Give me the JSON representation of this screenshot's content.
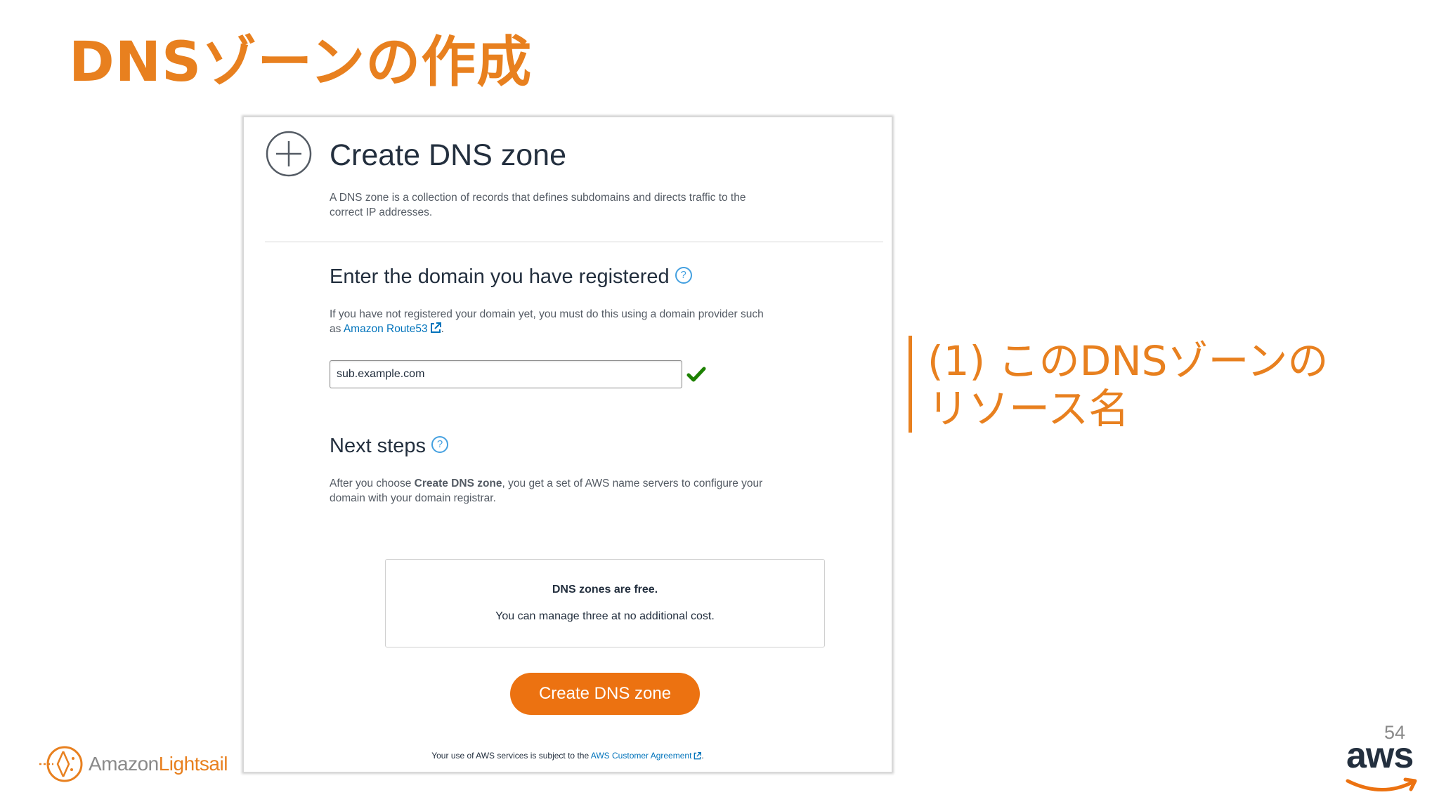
{
  "slide": {
    "title": "DNSゾーンの作成",
    "page_number": "54",
    "annotation": "(1) このDNSゾーンのリソース名",
    "brand_left": {
      "part1": "Amazon",
      "part2": "Lightsail"
    },
    "brand_right": "aws"
  },
  "card": {
    "title": "Create DNS zone",
    "description": "A DNS zone is a collection of records that defines subdomains and directs traffic to the correct IP addresses.",
    "domain_section": {
      "title": "Enter the domain you have registered",
      "help": "?",
      "desc_prefix": "If you have not registered your domain yet, you must do this using a domain provider such as ",
      "link": "Amazon Route53",
      "desc_suffix": ".",
      "input_value": "sub.example.com"
    },
    "next_section": {
      "title": "Next steps",
      "help": "?",
      "desc_prefix": "After you choose ",
      "desc_bold": "Create DNS zone",
      "desc_suffix": ", you get a set of AWS name servers to configure your domain with your domain registrar."
    },
    "info_box": {
      "title": "DNS zones are free.",
      "subtitle": "You can manage three at no additional cost."
    },
    "button_label": "Create DNS zone",
    "footer": {
      "prefix": "Your use of AWS services is subject to the ",
      "link": "AWS Customer Agreement",
      "suffix": "."
    }
  },
  "colors": {
    "accent_orange": "#e8801f",
    "button_orange": "#ec7211",
    "link_blue": "#0073bb",
    "success_green": "#1d8102",
    "text_dark": "#232f3e"
  },
  "icons": [
    "plus-circle-icon",
    "help-icon",
    "external-link-icon",
    "check-icon",
    "lightsail-logo-icon",
    "aws-smile-icon"
  ]
}
